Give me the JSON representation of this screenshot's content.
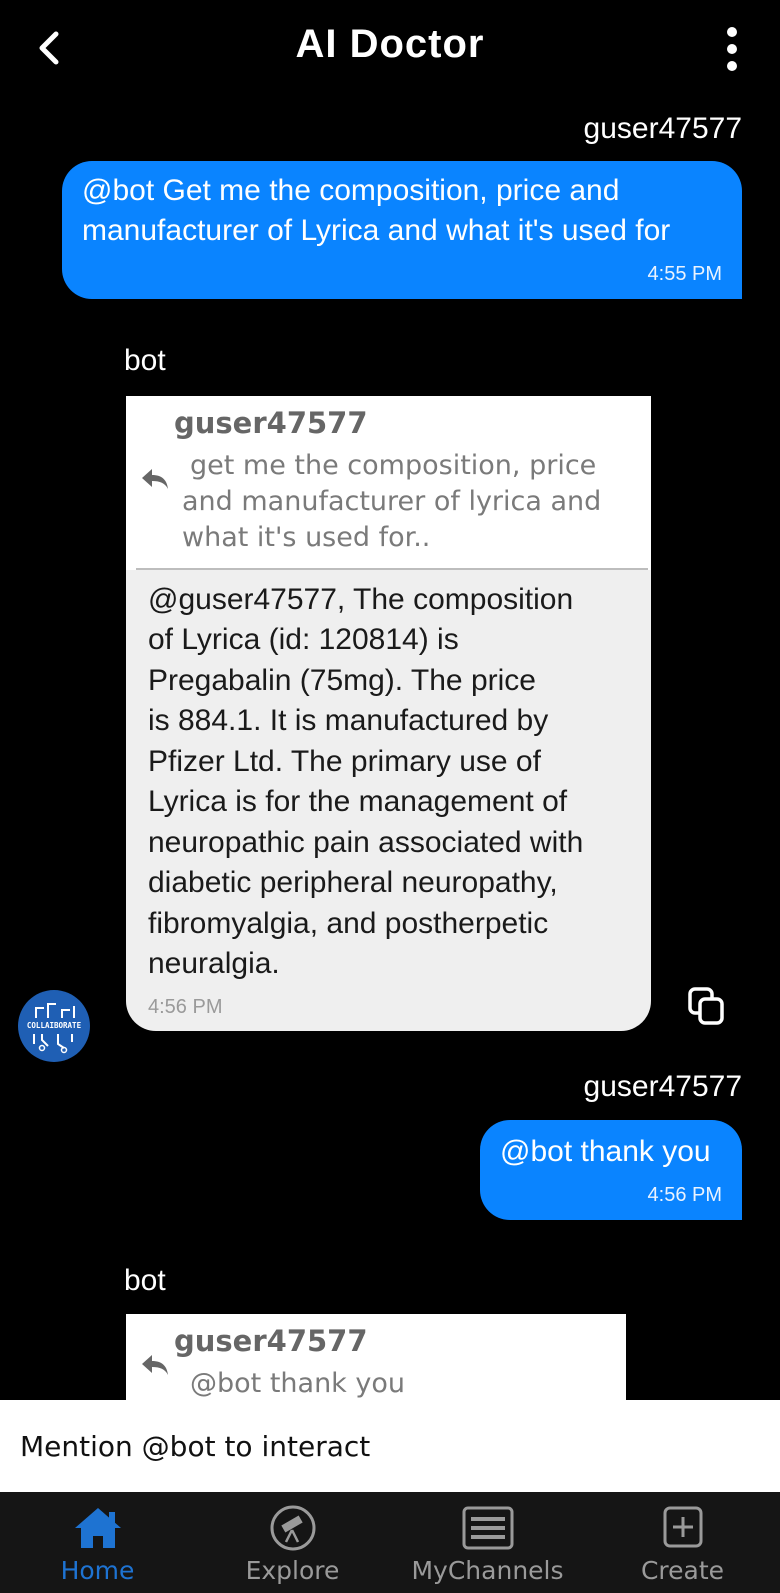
{
  "header": {
    "title": "AI Doctor"
  },
  "messages": {
    "m1": {
      "sender": "guser47577",
      "line1": "@bot Get me the composition, price and",
      "line2": "manufacturer of Lyrica and what it's used for",
      "time": "4:55 PM"
    },
    "m2": {
      "sender": "bot",
      "quote_name": "guser47577",
      "quote_line1": "get me the composition, price",
      "quote_line2": "and manufacturer of lyrica and",
      "quote_line3": "what it's used for..",
      "answer_lines": [
        "@guser47577, The composition",
        "of Lyrica (id: 120814) is",
        "Pregabalin (75mg). The price",
        "is 884.1. It is manufactured by",
        "Pfizer Ltd. The primary use of",
        "Lyrica is for the management of",
        "neuropathic pain associated with",
        "diabetic peripheral neuropathy,",
        "fibromyalgia, and postherpetic",
        "neuralgia."
      ],
      "time": "4:56 PM",
      "avatar_text": "COLLAIBORATE"
    },
    "m3": {
      "sender": "guser47577",
      "text": "@bot thank you",
      "time": "4:56 PM"
    },
    "m4": {
      "sender": "bot",
      "quote_name": "guser47577",
      "quote_partial": "@bot thank you"
    }
  },
  "input": {
    "placeholder": "Mention @bot to interact"
  },
  "nav": {
    "items": [
      {
        "label": "Home",
        "icon": "home-icon",
        "active": true
      },
      {
        "label": "Explore",
        "icon": "telescope-icon",
        "active": false
      },
      {
        "label": "MyChannels",
        "icon": "list-icon",
        "active": false
      },
      {
        "label": "Create",
        "icon": "plus-square-icon",
        "active": false
      }
    ]
  },
  "colors": {
    "background": "#000000",
    "outgoing_bubble": "#0a84ff",
    "nav_active": "#1e73d2",
    "avatar": "#1f5fb4"
  }
}
